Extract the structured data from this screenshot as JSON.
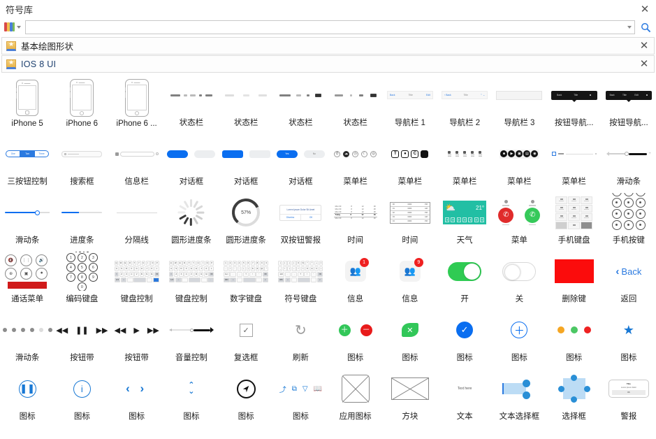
{
  "window": {
    "title": "符号库",
    "close_label": "✕"
  },
  "search": {
    "value": "",
    "placeholder": "",
    "library_icon": "library-stack-icon",
    "dropdown_icon": "chevron-down-icon",
    "search_icon": "magnifier-icon"
  },
  "categories": [
    {
      "title": "基本绘图形状",
      "star_icon": "★",
      "close_label": "✕",
      "style": "plain"
    },
    {
      "title": "IOS 8 UI",
      "star_icon": "★",
      "close_label": "✕",
      "style": "blue"
    }
  ],
  "colors": {
    "accent_blue": "#0a6ef0",
    "link_blue": "#2b7ae0",
    "icon_blue": "#1878d4",
    "green": "#32c759",
    "toggle_green": "#2fcb53",
    "red": "#e81b1b",
    "delete_red": "#fb0c0c",
    "teal": "#22bfa4",
    "orange": "#f5a623",
    "selection_fill": "#bcdcf5",
    "handle_blue": "#2a8fd6"
  },
  "shapes": [
    {
      "label": "iPhone 5",
      "kind": "phone5"
    },
    {
      "label": "iPhone 6",
      "kind": "phone6"
    },
    {
      "label": "iPhone 6 ...",
      "kind": "phone6plus"
    },
    {
      "label": "状态栏",
      "kind": "statusbar-a"
    },
    {
      "label": "状态栏",
      "kind": "statusbar-b"
    },
    {
      "label": "状态栏",
      "kind": "statusbar-c"
    },
    {
      "label": "状态栏",
      "kind": "statusbar-d"
    },
    {
      "label": "导航栏 1",
      "kind": "navbar1"
    },
    {
      "label": "导航栏 2",
      "kind": "navbar2"
    },
    {
      "label": "导航栏 3",
      "kind": "navbar3"
    },
    {
      "label": "按钮导航...",
      "kind": "navblack1"
    },
    {
      "label": "按钮导航...",
      "kind": "navblack2"
    },
    {
      "label": "三按钮控制",
      "kind": "segmented"
    },
    {
      "label": "搜索框",
      "kind": "searchbox"
    },
    {
      "label": "信息栏",
      "kind": "infobar"
    },
    {
      "label": "对话框",
      "kind": "dialog-pills-a"
    },
    {
      "label": "对话框",
      "kind": "dialog-pills-b"
    },
    {
      "label": "对话框",
      "kind": "dialog-pills-c"
    },
    {
      "label": "菜单栏",
      "kind": "menubar-circles"
    },
    {
      "label": "菜单栏",
      "kind": "menubar-squares"
    },
    {
      "label": "菜单栏",
      "kind": "menubar-columns"
    },
    {
      "label": "菜单栏",
      "kind": "menubar-group"
    },
    {
      "label": "菜单栏",
      "kind": "menubar-line"
    },
    {
      "label": "滑动条",
      "kind": "slider-dark"
    },
    {
      "label": "滑动条",
      "kind": "slider-blue"
    },
    {
      "label": "进度条",
      "kind": "progressbar"
    },
    {
      "label": "分隔线",
      "kind": "divider"
    },
    {
      "label": "圆形进度条",
      "kind": "spinner"
    },
    {
      "label": "圆形进度条",
      "kind": "ring",
      "percent": "57%"
    },
    {
      "label": "双按钮警报",
      "kind": "alert2",
      "message": "Lorem Ipsum Dolor Sit Amet",
      "buttons": [
        "Dismiss",
        "OK"
      ]
    },
    {
      "label": "时间",
      "kind": "timetable-a",
      "rows": [
        "Today"
      ]
    },
    {
      "label": "时间",
      "kind": "timetable-b"
    },
    {
      "label": "天气",
      "kind": "weather",
      "temp": "21°"
    },
    {
      "label": "菜单",
      "kind": "callmenu"
    },
    {
      "label": "手机键盘",
      "kind": "phone-keypad"
    },
    {
      "label": "手机按键",
      "kind": "dialpad"
    },
    {
      "label": "通话菜单",
      "kind": "call-menu-grid"
    },
    {
      "label": "编码键盘",
      "kind": "code-keypad"
    },
    {
      "label": "键盘控制",
      "kind": "keyboard-a"
    },
    {
      "label": "键盘控制",
      "kind": "keyboard-b"
    },
    {
      "label": "数字键盘",
      "kind": "keyboard-num"
    },
    {
      "label": "符号键盘",
      "kind": "keyboard-sym"
    },
    {
      "label": "信息",
      "kind": "badge-app",
      "badge": "1"
    },
    {
      "label": "信息",
      "kind": "badge-app",
      "badge": "9"
    },
    {
      "label": "开",
      "kind": "toggle-on"
    },
    {
      "label": "关",
      "kind": "toggle-off"
    },
    {
      "label": "删除键",
      "kind": "red-block"
    },
    {
      "label": "返回",
      "kind": "back-nav",
      "text": "Back"
    },
    {
      "label": "滑动条",
      "kind": "page-dots"
    },
    {
      "label": "按钮带",
      "kind": "media-pause"
    },
    {
      "label": "按钮带",
      "kind": "media-play"
    },
    {
      "label": "音量控制",
      "kind": "volume"
    },
    {
      "label": "复选框",
      "kind": "checkbox"
    },
    {
      "label": "刷新",
      "kind": "refresh"
    },
    {
      "label": "图标",
      "kind": "icon-plus-minus"
    },
    {
      "label": "图标",
      "kind": "icon-leaf-x"
    },
    {
      "label": "图标",
      "kind": "icon-check"
    },
    {
      "label": "图标",
      "kind": "icon-plus-outline"
    },
    {
      "label": "图标",
      "kind": "icon-3dots"
    },
    {
      "label": "图标",
      "kind": "icon-star"
    },
    {
      "label": "图标",
      "kind": "icon-pause-outline"
    },
    {
      "label": "图标",
      "kind": "icon-info-outline"
    },
    {
      "label": "图标",
      "kind": "icon-chevrons"
    },
    {
      "label": "图标",
      "kind": "icon-updown"
    },
    {
      "label": "图标",
      "kind": "icon-compass"
    },
    {
      "label": "图标",
      "kind": "icon-toolbar"
    },
    {
      "label": "应用图标",
      "kind": "app-icon-box"
    },
    {
      "label": "方块",
      "kind": "rect-box"
    },
    {
      "label": "文本",
      "kind": "text-here",
      "text": "Text here"
    },
    {
      "label": "文本选择框",
      "kind": "text-select"
    },
    {
      "label": "选择框",
      "kind": "select-box"
    },
    {
      "label": "警报",
      "kind": "alert-box",
      "title": "Title",
      "body": "Lorem Ipsum Dolor",
      "button": "OK"
    }
  ]
}
